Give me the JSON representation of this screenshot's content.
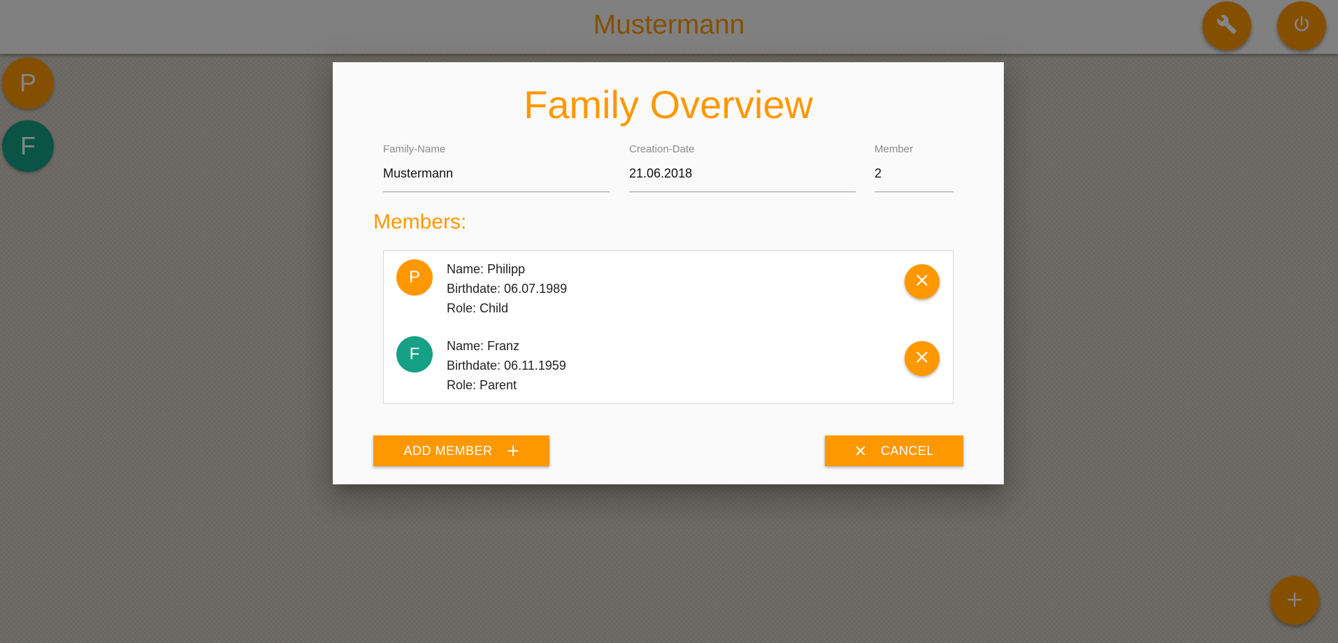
{
  "app": {
    "title": "Mustermann",
    "accent_color": "#ff9800",
    "settings_icon": "wrench-icon",
    "power_icon": "power-icon",
    "add_icon": "plus-icon"
  },
  "sidebar": {
    "avatars": [
      {
        "initial": "P",
        "color": "#ff9800"
      },
      {
        "initial": "F",
        "color": "#16a085"
      }
    ]
  },
  "dialog": {
    "title": "Family Overview",
    "fields": {
      "family_name": {
        "label": "Family-Name",
        "value": "Mustermann"
      },
      "creation_date": {
        "label": "Creation-Date",
        "value": "21.06.2018"
      },
      "member_count": {
        "label": "Member",
        "value": "2"
      }
    },
    "members_heading": "Members:",
    "members": [
      {
        "initial": "P",
        "color": "#ff9800",
        "name": "Name: Philipp",
        "birthdate": "Birthdate: 06.07.1989",
        "role": "Role: Child"
      },
      {
        "initial": "F",
        "color": "#16a085",
        "name": "Name: Franz",
        "birthdate": "Birthdate: 06.11.1959",
        "role": "Role: Parent"
      }
    ],
    "add_member_label": "ADD MEMBER",
    "cancel_label": "CANCEL"
  }
}
